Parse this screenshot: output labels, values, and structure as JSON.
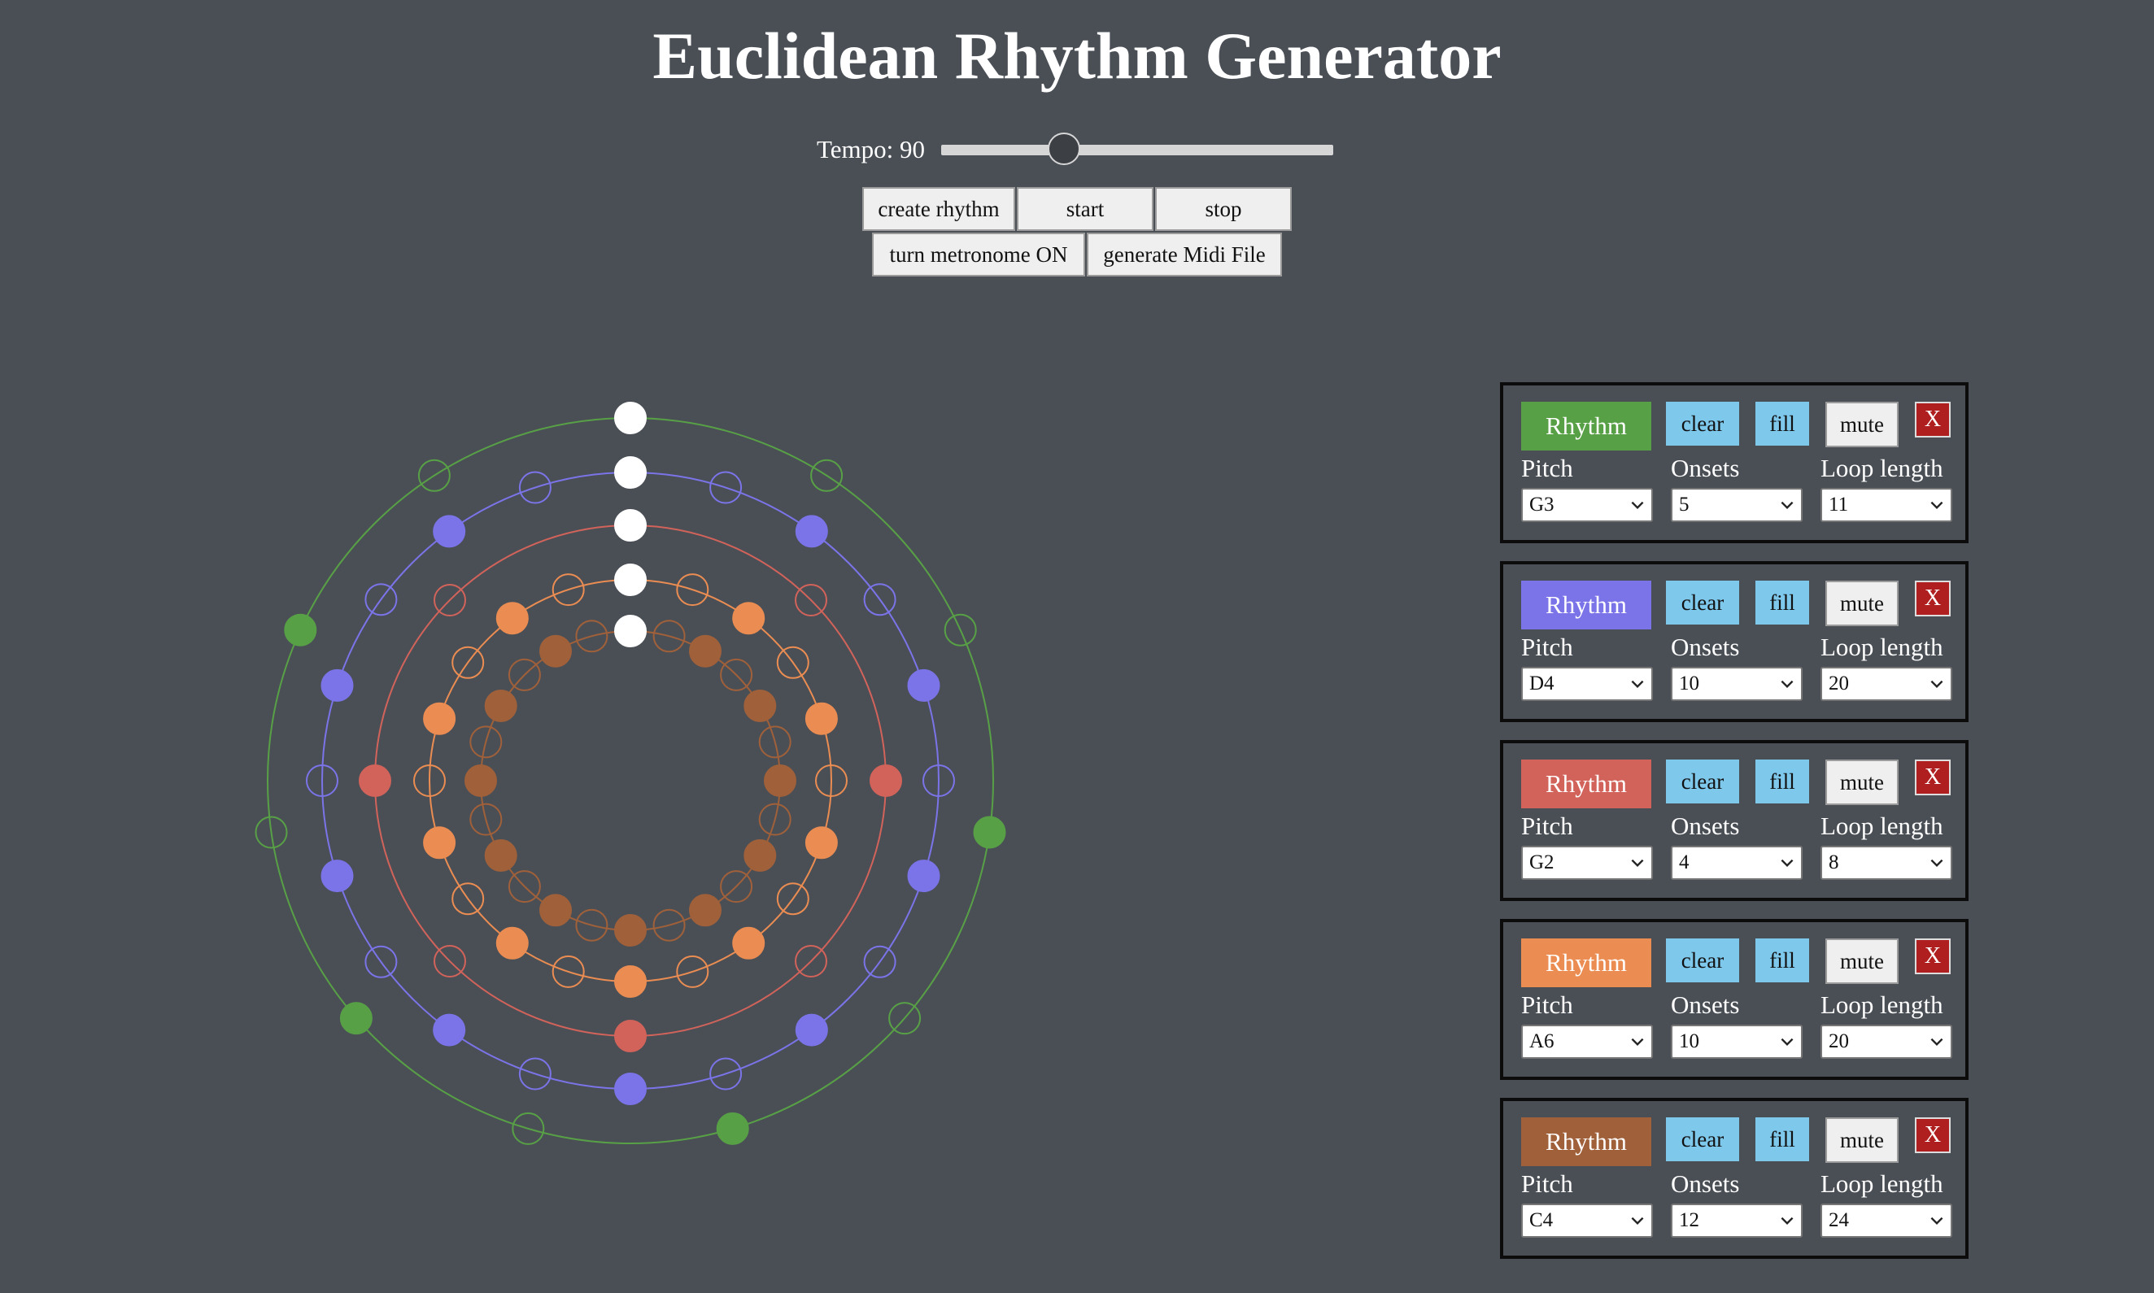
{
  "title": "Euclidean Rhythm Generator",
  "tempo": {
    "label": "Tempo: 90",
    "value": 90,
    "min": 40,
    "max": 200
  },
  "controls": {
    "create": "create rhythm",
    "start": "start",
    "stop": "stop",
    "metronome": "turn metronome ON",
    "midi": "generate Midi File"
  },
  "panel_labels": {
    "clear": "clear",
    "fill": "fill",
    "mute": "mute",
    "delete": "X",
    "pitch": "Pitch",
    "onsets": "Onsets",
    "loop": "Loop length"
  },
  "rhythms": [
    {
      "name": "Rhythm",
      "color": "#58a046",
      "pitch": "G3",
      "onsets": "5",
      "loop": "11"
    },
    {
      "name": "Rhythm",
      "color": "#7b74e8",
      "pitch": "D4",
      "onsets": "10",
      "loop": "20"
    },
    {
      "name": "Rhythm",
      "color": "#d2635a",
      "pitch": "G2",
      "onsets": "4",
      "loop": "8"
    },
    {
      "name": "Rhythm",
      "color": "#eb8d52",
      "pitch": "A6",
      "onsets": "10",
      "loop": "20"
    },
    {
      "name": "Rhythm",
      "color": "#a0603a",
      "pitch": "C4",
      "onsets": "12",
      "loop": "24"
    }
  ]
}
